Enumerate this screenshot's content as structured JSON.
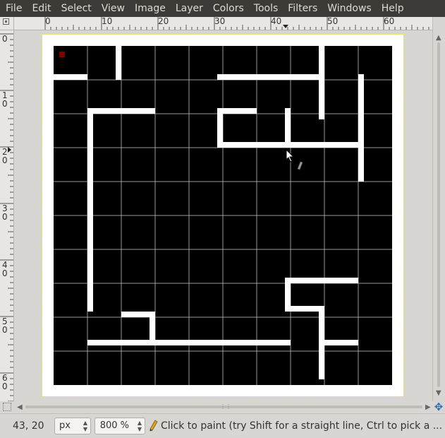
{
  "menubar": {
    "items": [
      {
        "label": "File"
      },
      {
        "label": "Edit"
      },
      {
        "label": "Select"
      },
      {
        "label": "View"
      },
      {
        "label": "Image"
      },
      {
        "label": "Layer"
      },
      {
        "label": "Colors"
      },
      {
        "label": "Tools"
      },
      {
        "label": "Filters"
      },
      {
        "label": "Windows"
      },
      {
        "label": "Help"
      }
    ]
  },
  "ruler": {
    "horizontal_labels": [
      "0",
      "10",
      "20",
      "30",
      "40",
      "50",
      "60"
    ],
    "vertical_labels": [
      "0",
      "1\n0",
      "2\n0",
      "3\n0",
      "4\n0",
      "5\n0",
      "6\n0"
    ]
  },
  "canvas": {
    "background": "#ffffff",
    "cell_color": "#000000",
    "grid_color": "#9a9a9a",
    "accent_pixel_color": "#7a0000",
    "guide_color": "#f0e64a"
  },
  "statusbar": {
    "coords": "43, 20",
    "unit": "px",
    "zoom": "800 %",
    "message": "Click to paint (try Shift for a straight line, Ctrl to pick a ..."
  },
  "icons": {
    "pencil": "pencil-icon",
    "navigate": "navigate-icon"
  }
}
